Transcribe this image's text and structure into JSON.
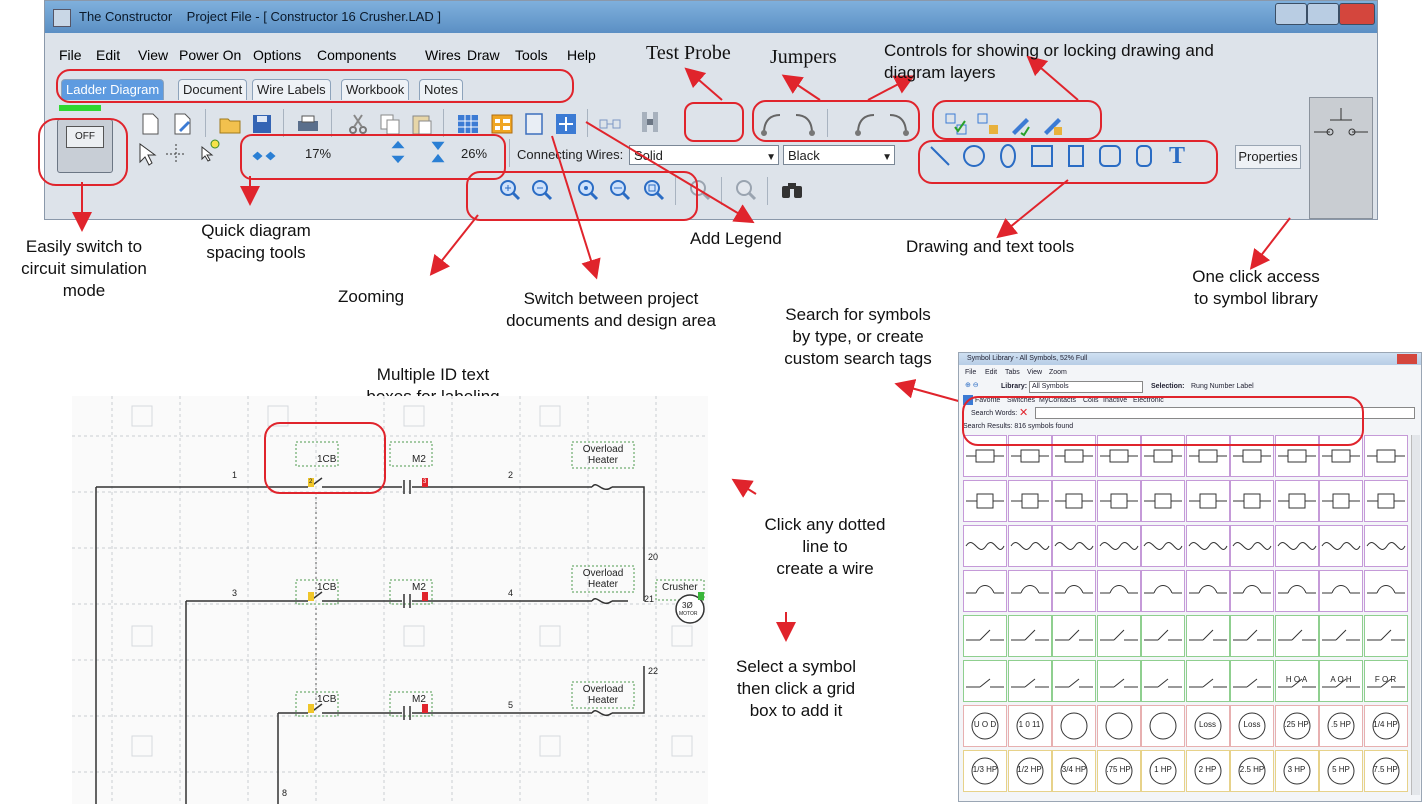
{
  "window": {
    "app_name": "The Constructor",
    "project_title": "Project File - [ Constructor 16 Crusher.LAD ]"
  },
  "menu": [
    "File",
    "Edit",
    "View",
    "Power On",
    "Options",
    "Components",
    "Wires",
    "Draw",
    "Tools",
    "Help"
  ],
  "tabs": [
    "Ladder Diagram",
    "Document",
    "Wire Labels",
    "Workbook",
    "Notes"
  ],
  "toolbar": {
    "sim_button": "OFF",
    "horizontal_spacing": "17%",
    "vertical_spacing": "26%",
    "connecting_wires_label": "Connecting Wires:",
    "wire_style": "Solid",
    "wire_color": "Black",
    "properties": "Properties"
  },
  "annotations": {
    "test_probe": "Test Probe",
    "jumpers": "Jumpers",
    "layers_line1": "Controls for showing or locking drawing and",
    "layers_line2": "diagram layers",
    "easily_1": "Easily switch to",
    "easily_2": "circuit simulation",
    "easily_3": "mode",
    "quick_1": "Quick diagram",
    "quick_2": "spacing tools",
    "add_legend": "Add Legend",
    "drawing_tools": "Drawing and text tools",
    "one_click_1": "One click access",
    "one_click_2": "to symbol library",
    "zooming": "Zooming",
    "switch_1": "Switch between project",
    "switch_2": "documents and design area",
    "search_1": "Search for symbols",
    "search_2": "by type, or create",
    "search_3": "custom search tags",
    "multi_1": "Multiple ID text",
    "multi_2": "boxes for labeling",
    "click_1": "Click any dotted",
    "click_2": "line to",
    "click_3": "create a wire",
    "select_1": "Select a symbol",
    "select_2": "then click a grid",
    "select_3": "box to add it"
  },
  "diagram": {
    "rung_labels": [
      "1",
      "2",
      "3",
      "4",
      "5",
      "20",
      "21",
      "22",
      "8"
    ],
    "cb_label": "1CB",
    "m_label": "M2",
    "overload_1": "Overload",
    "overload_2": "Heater",
    "crusher": "Crusher",
    "motor": "3Ø",
    "motor_sub": "MOTOR",
    "marker_2": "2",
    "marker_3": "3"
  },
  "library": {
    "title": "Symbol Library - All Symbols, 52% Full",
    "menu": [
      "File",
      "Edit",
      "Tabs",
      "View",
      "Zoom"
    ],
    "library_label": "Library:",
    "library_value": "All Symbols",
    "selection_label": "Selection:",
    "selection_value": "Rung Number Label",
    "tabs": [
      "All",
      "Favorite",
      "Switches",
      "MyContacts",
      "Coils",
      "Inactive",
      "Electronic"
    ],
    "search_words": "Search Words:",
    "search_results": "Search Results: 816 symbols found",
    "row6": [
      "H O A",
      "A O H",
      "F O R"
    ],
    "row7": [
      "U O D",
      "1 0 11",
      "Loss",
      "Loss",
      ".25 HP",
      ".5 HP",
      "1/4 HP"
    ],
    "row8": [
      "1/3 HP",
      "1/2 HP",
      "3/4 HP",
      ".75 HP",
      "1 HP",
      "2 HP",
      "2.5 HP",
      "3 HP",
      "5 HP",
      "7.5 HP"
    ]
  },
  "colors": {
    "accent": "#e0242c",
    "tab_active": "#5e9be0",
    "grid": "#cfd3d8"
  }
}
